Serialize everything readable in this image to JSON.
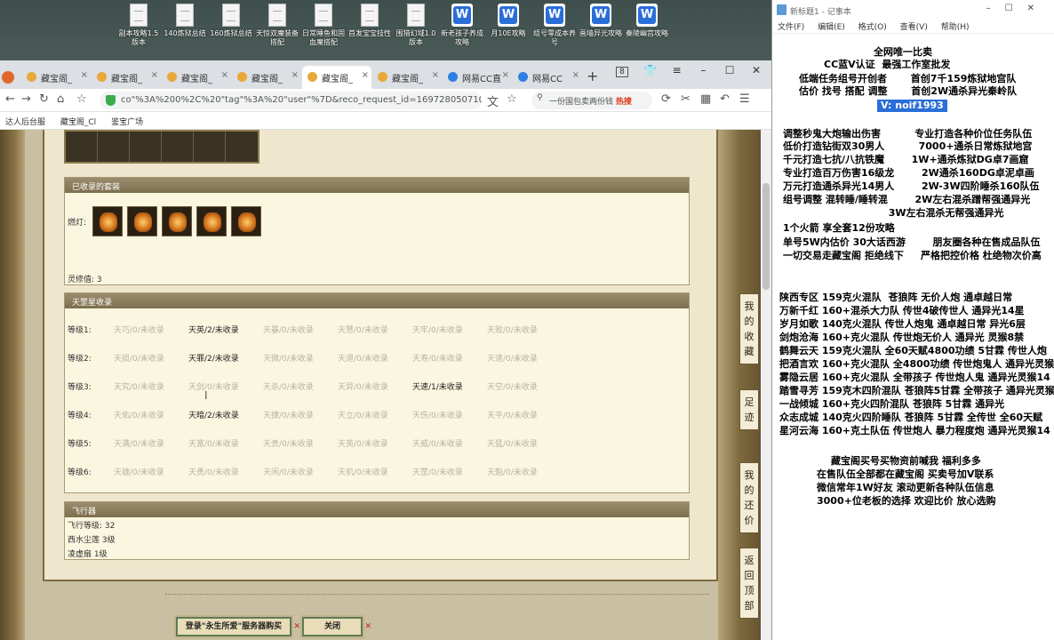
{
  "desktop": {
    "icons": [
      {
        "label": "副本攻略1.5版本",
        "kind": "file"
      },
      {
        "label": "140炼狱总结",
        "kind": "file"
      },
      {
        "label": "160炼狱总结",
        "kind": "file"
      },
      {
        "label": "天惊双魔装备搭配",
        "kind": "file"
      },
      {
        "label": "日常睡鱼和固血魔搭配",
        "kind": "file"
      },
      {
        "label": "首发宝宝技性",
        "kind": "file"
      },
      {
        "label": "围猎幻域1.0版本",
        "kind": "file"
      },
      {
        "label": "新老孩子养成攻略",
        "kind": "word"
      },
      {
        "label": "月10E攻略",
        "kind": "word"
      },
      {
        "label": "组号零成本养号",
        "kind": "word"
      },
      {
        "label": "画墙异光攻略",
        "kind": "word"
      },
      {
        "label": "秦陵幽宫攻略",
        "kind": "word"
      }
    ]
  },
  "browser": {
    "tabs": [
      {
        "label": "藏宝阁_",
        "blue": false
      },
      {
        "label": "藏宝阁_",
        "blue": false
      },
      {
        "label": "藏宝阁_",
        "blue": false
      },
      {
        "label": "藏宝阁_",
        "blue": false
      },
      {
        "label": "藏宝阁_",
        "blue": false,
        "active": true
      },
      {
        "label": "藏宝阁_",
        "blue": false
      },
      {
        "label": "网易CC直",
        "blue": true
      },
      {
        "label": "网易CC",
        "blue": true
      }
    ],
    "tab_count_badge": "8",
    "address": "co\"%3A%200%2C%20\"tag\"%3A%20\"user\"%7D&reco_request_id=16972805071077S3Q2",
    "search_placeholder": "一份国包卖两份钱",
    "search_hot": "热搜",
    "bookmarks": [
      "达人后台服",
      "藏宝阁_Cl",
      "鉴宝广场"
    ]
  },
  "game": {
    "collected_sets_title": "已收录的套装",
    "lamp_label": "燃灯:",
    "spirit_value_label": "灵修值:",
    "spirit_value": "3",
    "tianshen_title": "天罡星收录",
    "levels": [
      {
        "label": "等级1:",
        "cells": [
          {
            "t": "天巧/0/未收录",
            "on": false
          },
          {
            "t": "天英/2/未收录",
            "on": true
          },
          {
            "t": "天暴/0/未收录",
            "on": false
          },
          {
            "t": "天慧/0/未收录",
            "on": false
          },
          {
            "t": "天牢/0/未收录",
            "on": false
          },
          {
            "t": "天败/0/未收录",
            "on": false
          }
        ]
      },
      {
        "label": "等级2:",
        "cells": [
          {
            "t": "天损/0/未收录",
            "on": false
          },
          {
            "t": "天罪/2/未收录",
            "on": true
          },
          {
            "t": "天微/0/未收录",
            "on": false
          },
          {
            "t": "天退/0/未收录",
            "on": false
          },
          {
            "t": "天寿/0/未收录",
            "on": false
          },
          {
            "t": "天速/0/未收录",
            "on": false
          }
        ]
      },
      {
        "label": "等级3:",
        "cells": [
          {
            "t": "天究/0/未收录",
            "on": false
          },
          {
            "t": "天剑/0/未收录",
            "on": false
          },
          {
            "t": "天杀/0/未收录",
            "on": false
          },
          {
            "t": "天异/0/未收录",
            "on": false
          },
          {
            "t": "天速/1/未收录",
            "on": true
          },
          {
            "t": "天空/0/未收录",
            "on": false
          }
        ]
      },
      {
        "label": "等级4:",
        "cells": [
          {
            "t": "天佑/0/未收录",
            "on": false
          },
          {
            "t": "天暗/2/未收录",
            "on": true
          },
          {
            "t": "天捷/0/未收录",
            "on": false
          },
          {
            "t": "天立/0/未收录",
            "on": false
          },
          {
            "t": "天伤/0/未收录",
            "on": false
          },
          {
            "t": "天平/0/未收录",
            "on": false
          }
        ]
      },
      {
        "label": "等级5:",
        "cells": [
          {
            "t": "天满/0/未收录",
            "on": false
          },
          {
            "t": "天富/0/未收录",
            "on": false
          },
          {
            "t": "天贵/0/未收录",
            "on": false
          },
          {
            "t": "天英/0/未收录",
            "on": false
          },
          {
            "t": "天威/0/未收录",
            "on": false
          },
          {
            "t": "天猛/0/未收录",
            "on": false
          }
        ]
      },
      {
        "label": "等级6:",
        "cells": [
          {
            "t": "天雄/0/未收录",
            "on": false
          },
          {
            "t": "天勇/0/未收录",
            "on": false
          },
          {
            "t": "天闲/0/未收录",
            "on": false
          },
          {
            "t": "天机/0/未收录",
            "on": false
          },
          {
            "t": "天罡/0/未收录",
            "on": false
          },
          {
            "t": "天魁/0/未收录",
            "on": false
          }
        ]
      }
    ],
    "aircraft_title": "飞行器",
    "aircraft_level": "飞行等级: 32",
    "aircraft_item1": "西水尘莲  3级",
    "aircraft_item2": "凌虚扇  1级",
    "side_buttons": [
      "我的收藏",
      "足迹",
      "我的还价",
      "返回顶部"
    ],
    "login_button": "登录\"永生所爱\"服务器购买",
    "close_button": "关闭"
  },
  "notepad": {
    "title": "新标题1 - 记事本",
    "menu": [
      "文件(F)",
      "编辑(E)",
      "格式(O)",
      "查看(V)",
      "帮助(H)"
    ],
    "lines": [
      "全网唯一比卖",
      "CC蓝V认证  最强工作室批发",
      "低端任务组号开创者       首创7千159炼狱地宫队",
      "估价 找号 搭配 调整       首创2W通杀异光秦岭队",
      "V: noif1993",
      "调整秒鬼大炮输出伤害          专业打造各种价位任务队伍",
      "低价打造钻街双30男人          7000+通杀日常炼狱地宫",
      "千元打造七抗/八抗铁魔        1W+通杀炼狱DG卓7画窟",
      "专业打造百万伤害16级龙        2W通杀160DG卓泥卓画",
      "万元打造通杀异光14男人        2W-3W四阶睡杀160队伍",
      "组号调整 混转睡/睡转混        2W左右混杀蹭帮强通异光",
      "                               3W左右混杀无帮强通异光",
      "1个火箭 享全套12份攻略",
      "单号5W内估价 30大话西游        朋友圈各种在售成品队伍",
      "一切交易走藏宝阁 拒绝线下     严格把控价格 杜绝物次价高",
      "陕西专区 159克火混队  苍狼阵 无价人炮 通卓越日常",
      "万新千红 160+混杀大力队 传世4破传世人 通异光14星",
      "岁月如歌 140克火混队 传世人炮鬼 通卓越日常 异光6层",
      "剑炮沧海 160+克火混队 传世炮无价人 通异光 灵猴8禁",
      "鹤舞云天 159克火混队 全60天赋4800功绩 5甘霖 传世人炮",
      "把酒言欢 160+克火混队 全4800功绩 传世炮鬼人 通异光灵猴",
      "雾隐云居 160+克火混队 全带孩子 传世炮人鬼 通异光灵猴14",
      "踏雪寻芳 159克木四阶混队 苍狼阵5甘霖 全带孩子 通异光灵猴",
      "一战倾城 160+克火四阶混队 苍狼阵 5甘霖 通异光",
      "众志成城 140克火四阶睡队 苍狼阵 5甘霖 全传世 全60天赋",
      "星河云海 160+克土队伍 传世炮人 暴力程度炮 通异光灵猴14",
      "藏宝阁买号买物资前喊我 福利多多",
      "在售队伍全部都在藏宝阁 买卖号加V联系",
      "微信常年1W好友 滚动更新各种队伍信息",
      "3000+位老板的选择 欢迎比价 放心选购"
    ]
  }
}
